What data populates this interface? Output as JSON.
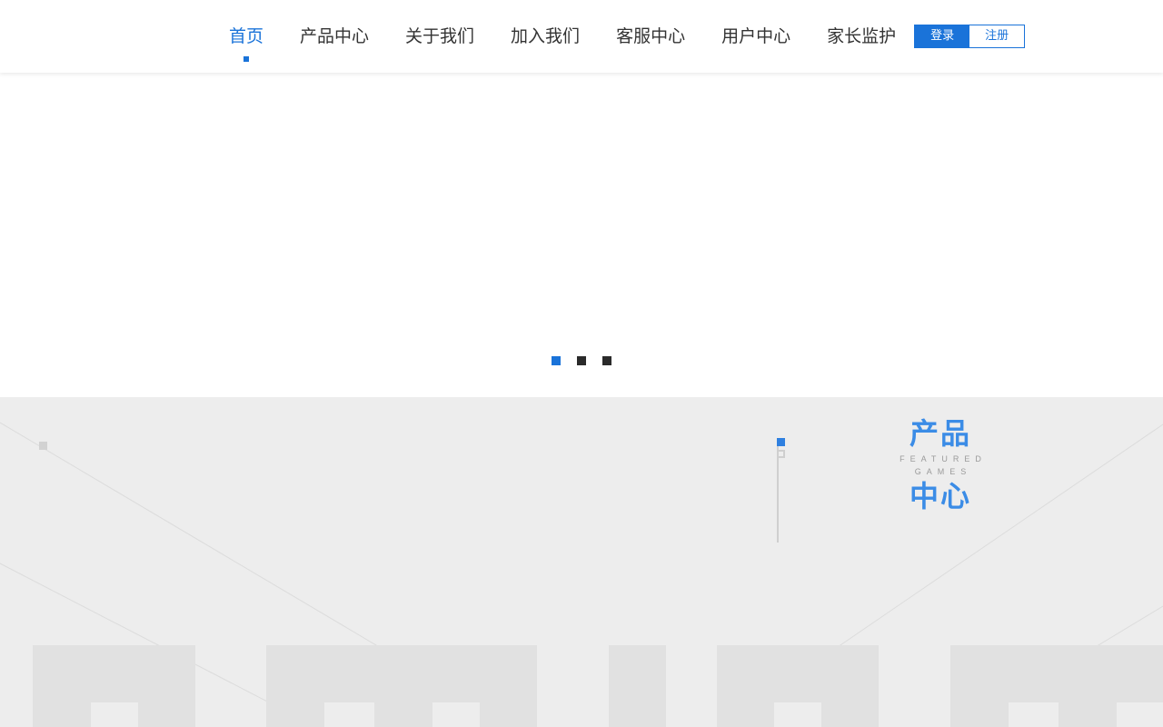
{
  "nav": {
    "items": [
      {
        "label": "首页",
        "active": true
      },
      {
        "label": "产品中心",
        "active": false
      },
      {
        "label": "关于我们",
        "active": false
      },
      {
        "label": "加入我们",
        "active": false
      },
      {
        "label": "客服中心",
        "active": false
      },
      {
        "label": "用户中心",
        "active": false
      },
      {
        "label": "家长监护",
        "active": false
      }
    ],
    "login_label": "登录",
    "register_label": "注册"
  },
  "banner": {
    "slide_count": 3,
    "active_slide": 1
  },
  "product_section": {
    "title_line1": "产品",
    "title_line2": "中心",
    "subtitle": "FEATURED GAMES"
  },
  "colors": {
    "accent": "#1a73d9",
    "title_blue": "#3b8ce6",
    "section_bg": "#ededed",
    "inactive_dot": "#2a2a2a"
  }
}
